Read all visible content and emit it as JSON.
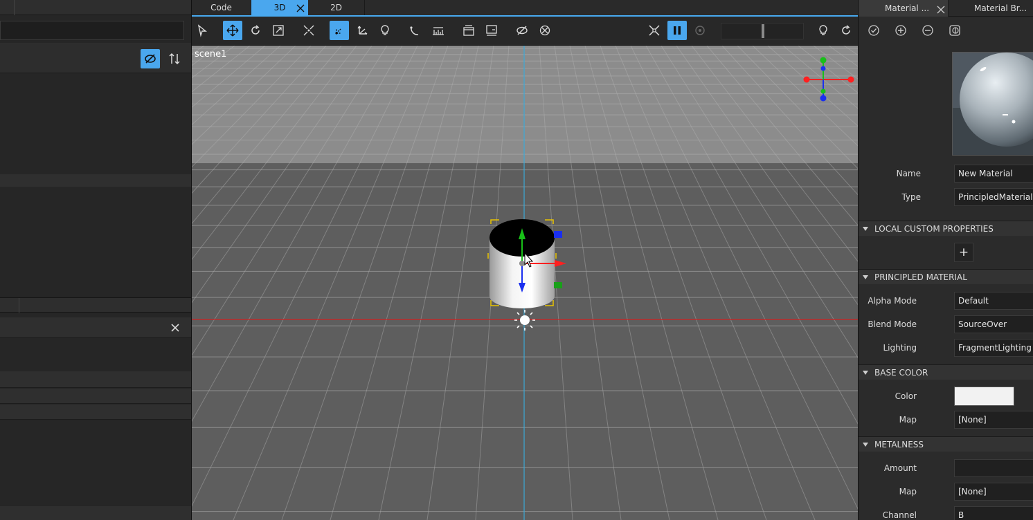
{
  "center_tabs": {
    "code": "Code",
    "three_d": "3D",
    "two_d": "2D"
  },
  "viewport": {
    "scene_label": "scene1"
  },
  "right_tabs": {
    "material_editor": "Material ...",
    "material_browser": "Material Br..."
  },
  "material": {
    "name_label": "Name",
    "name_value": "New Material",
    "type_label": "Type",
    "type_value": "PrincipledMaterial"
  },
  "sections": {
    "local_custom": "LOCAL CUSTOM PROPERTIES",
    "principled": "PRINCIPLED MATERIAL",
    "base_color": "BASE COLOR",
    "metalness": "METALNESS"
  },
  "principled": {
    "alpha_label": "Alpha Mode",
    "alpha_value": "Default",
    "blend_label": "Blend Mode",
    "blend_value": "SourceOver",
    "lighting_label": "Lighting",
    "lighting_value": "FragmentLighting"
  },
  "base_color": {
    "color_label": "Color",
    "color_value": "#f2f2f2",
    "map_label": "Map",
    "map_value": "[None]"
  },
  "metalness": {
    "amount_label": "Amount",
    "amount_value": "",
    "map_label": "Map",
    "map_value": "[None]",
    "channel_label": "Channel",
    "channel_value": "B"
  },
  "add_property_label": "+",
  "colors": {
    "accent": "#4aa7ee",
    "x_axis": "#ff2020",
    "y_axis": "#18c018",
    "z_axis": "#1a2ff0"
  }
}
